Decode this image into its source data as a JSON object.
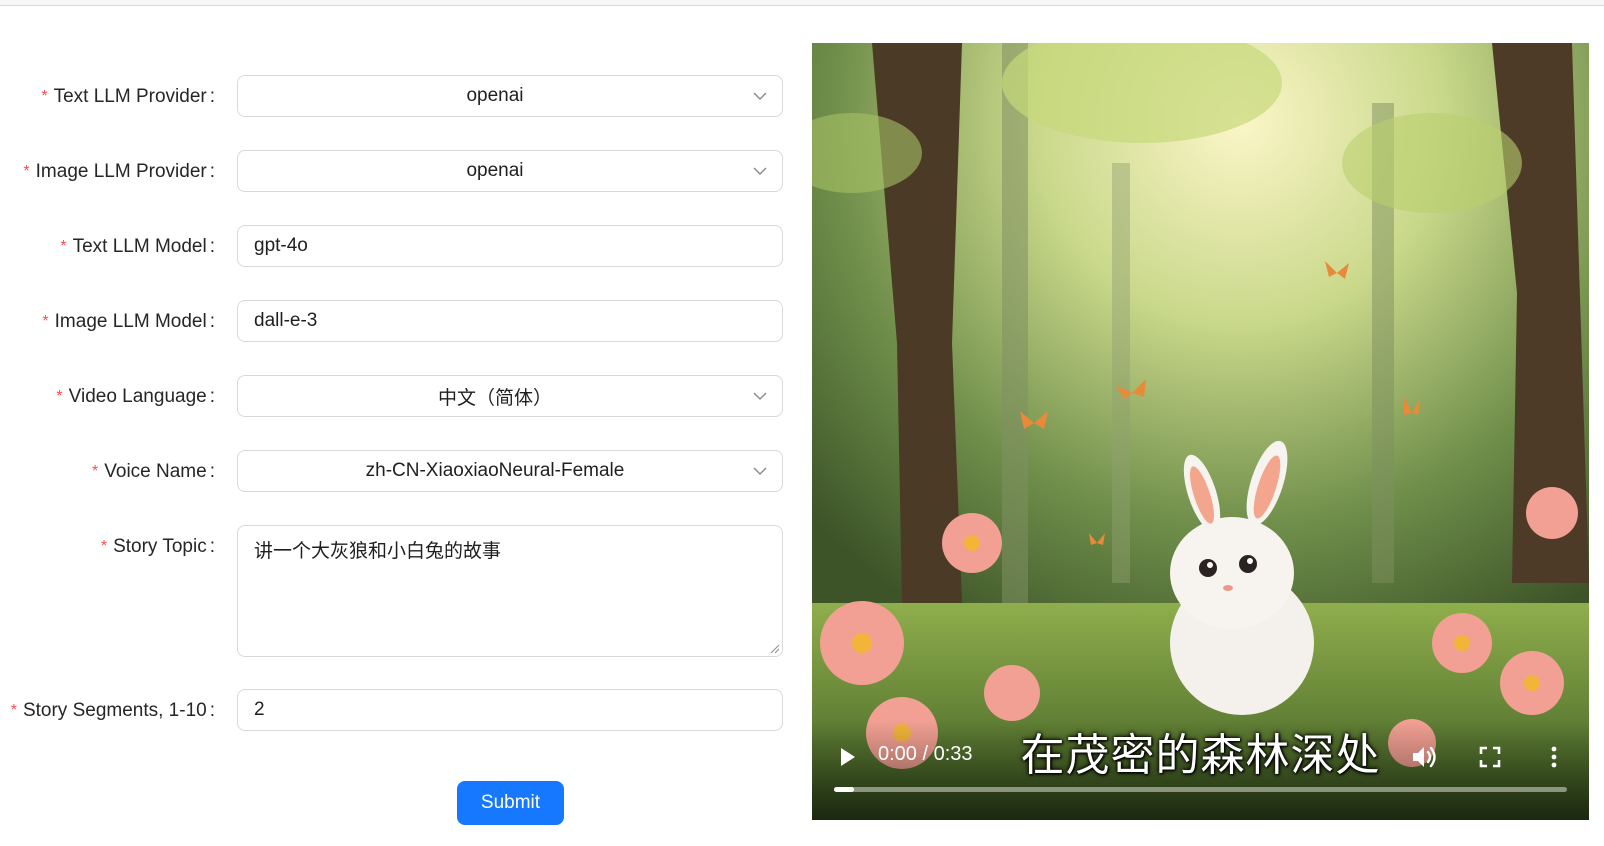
{
  "form": {
    "fields": [
      {
        "label": "Text LLM Provider",
        "type": "select",
        "value": "openai"
      },
      {
        "label": "Image LLM Provider",
        "type": "select",
        "value": "openai"
      },
      {
        "label": "Text LLM Model",
        "type": "input",
        "value": "gpt-4o"
      },
      {
        "label": "Image LLM Model",
        "type": "input",
        "value": "dall-e-3"
      },
      {
        "label": "Video Language",
        "type": "select",
        "value": "中文（简体）"
      },
      {
        "label": "Voice Name",
        "type": "select",
        "value": "zh-CN-XiaoxiaoNeural-Female"
      },
      {
        "label": "Story Topic",
        "type": "textarea",
        "value": "讲一个大灰狼和小白兔的故事"
      },
      {
        "label": "Story Segments, 1-10",
        "type": "input",
        "value": "2"
      }
    ],
    "required_mark": "*",
    "colon": ":",
    "submit_label": "Submit"
  },
  "video": {
    "subtitle": "在茂密的森林深处",
    "current_time": "0:00",
    "separator": "/",
    "duration": "0:33",
    "progress_fraction": 0.0,
    "icons": [
      "play-icon",
      "volume-icon",
      "fullscreen-icon",
      "more-options-icon"
    ]
  },
  "colors": {
    "accent": "#1677ff",
    "required": "#ff4d4f",
    "border": "#d9d9d9"
  }
}
